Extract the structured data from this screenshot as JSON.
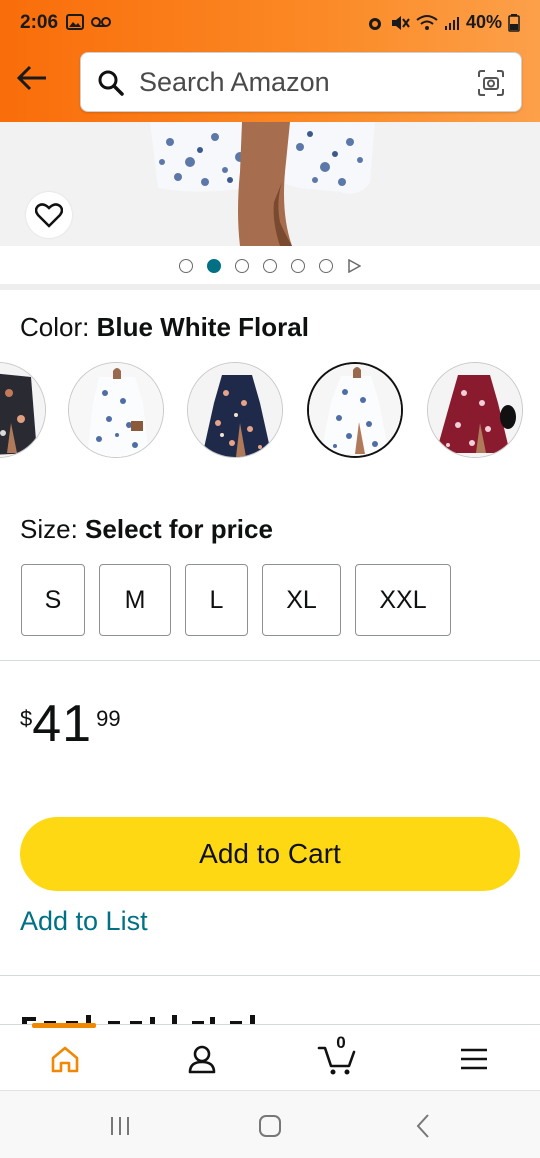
{
  "status_bar": {
    "time": "2:06",
    "battery": "40%"
  },
  "search": {
    "placeholder": "Search Amazon"
  },
  "carousel": {
    "total": 6,
    "active_index": 1
  },
  "color": {
    "label": "Color:",
    "selected": "Blue White Floral",
    "swatches": [
      "Black Floral",
      "White Floral",
      "Navy Floral",
      "Blue White Floral",
      "Burgundy Floral"
    ],
    "selected_index": 3
  },
  "size": {
    "label": "Size:",
    "prompt": "Select for price",
    "options": [
      "S",
      "M",
      "L",
      "XL",
      "XXL"
    ]
  },
  "price": {
    "symbol": "$",
    "whole": "41",
    "fraction": "99"
  },
  "actions": {
    "add_to_cart": "Add to Cart",
    "add_to_list": "Add to List"
  },
  "section": {
    "partial_heading": "Product details"
  },
  "bottom_nav": {
    "cart_count": "0",
    "active": "home"
  },
  "colors": {
    "header_orange": "#f96d0a",
    "cart_yellow": "#ffd814",
    "link_teal": "#007185",
    "nav_active": "#f08804"
  }
}
